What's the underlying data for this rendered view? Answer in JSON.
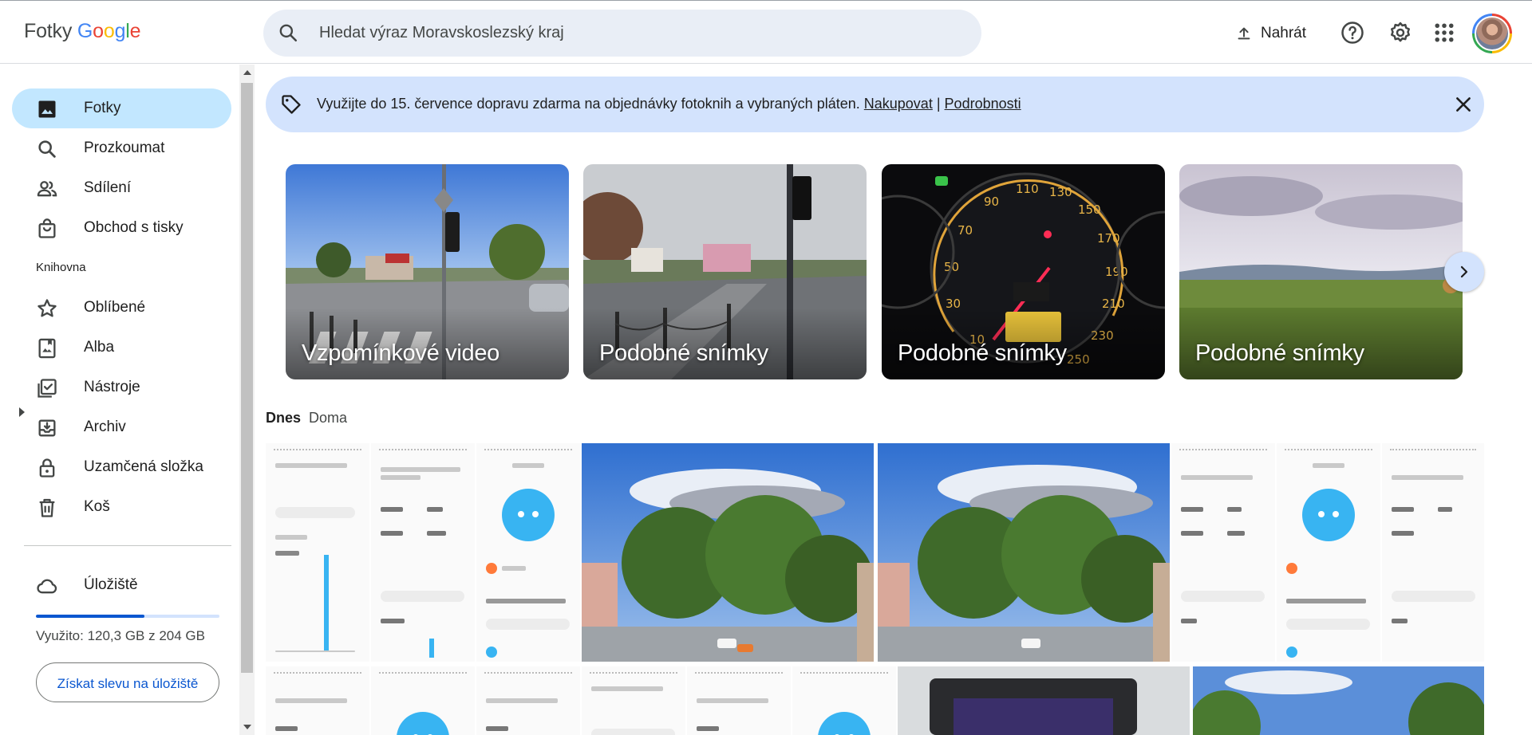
{
  "header": {
    "logo_word": "Fotky",
    "logo_brand_letters": [
      "G",
      "o",
      "o",
      "g",
      "l",
      "e"
    ],
    "search_placeholder": "Hledat výraz Moravskoslezský kraj",
    "upload_label": "Nahrát",
    "icons": [
      "search-icon",
      "upload-icon",
      "help-icon",
      "gear-icon",
      "apps-grid-icon",
      "avatar"
    ]
  },
  "sidebar": {
    "items": [
      {
        "label": "Fotky",
        "icon": "photo-icon",
        "active": true
      },
      {
        "label": "Prozkoumat",
        "icon": "search-icon"
      },
      {
        "label": "Sdílení",
        "icon": "people-icon"
      },
      {
        "label": "Obchod s tisky",
        "icon": "shopping-bag-icon"
      }
    ],
    "library_heading": "Knihovna",
    "library_items": [
      {
        "label": "Oblíbené",
        "icon": "star-icon"
      },
      {
        "label": "Alba",
        "icon": "album-icon"
      },
      {
        "label": "Nástroje",
        "icon": "tools-icon"
      },
      {
        "label": "Archiv",
        "icon": "archive-icon"
      },
      {
        "label": "Uzamčená složka",
        "icon": "lock-icon"
      },
      {
        "label": "Koš",
        "icon": "trash-icon"
      }
    ],
    "storage": {
      "label": "Úložiště",
      "icon": "cloud-icon",
      "used_text": "Využito: 120,3 GB z 204 GB",
      "used_fraction": 0.59,
      "button_label": "Získat slevu na úložiště"
    }
  },
  "banner": {
    "text": "Využijte do 15. července dopravu zdarma na objednávky fotoknih a vybraných pláten.",
    "link1": "Nakupovat",
    "separator": "|",
    "link2": "Podrobnosti"
  },
  "memories": [
    {
      "title": "Vzpomínkové video"
    },
    {
      "title": "Podobné snímky"
    },
    {
      "title": "Podobné snímky"
    },
    {
      "title": "Podobné snímky"
    }
  ],
  "date_section": {
    "date": "Dnes",
    "place": "Doma"
  },
  "colors": {
    "accent": "#0b57d0",
    "active_nav": "#c2e7ff",
    "banner": "#d3e3fd",
    "search_bg": "#e9eef6"
  }
}
